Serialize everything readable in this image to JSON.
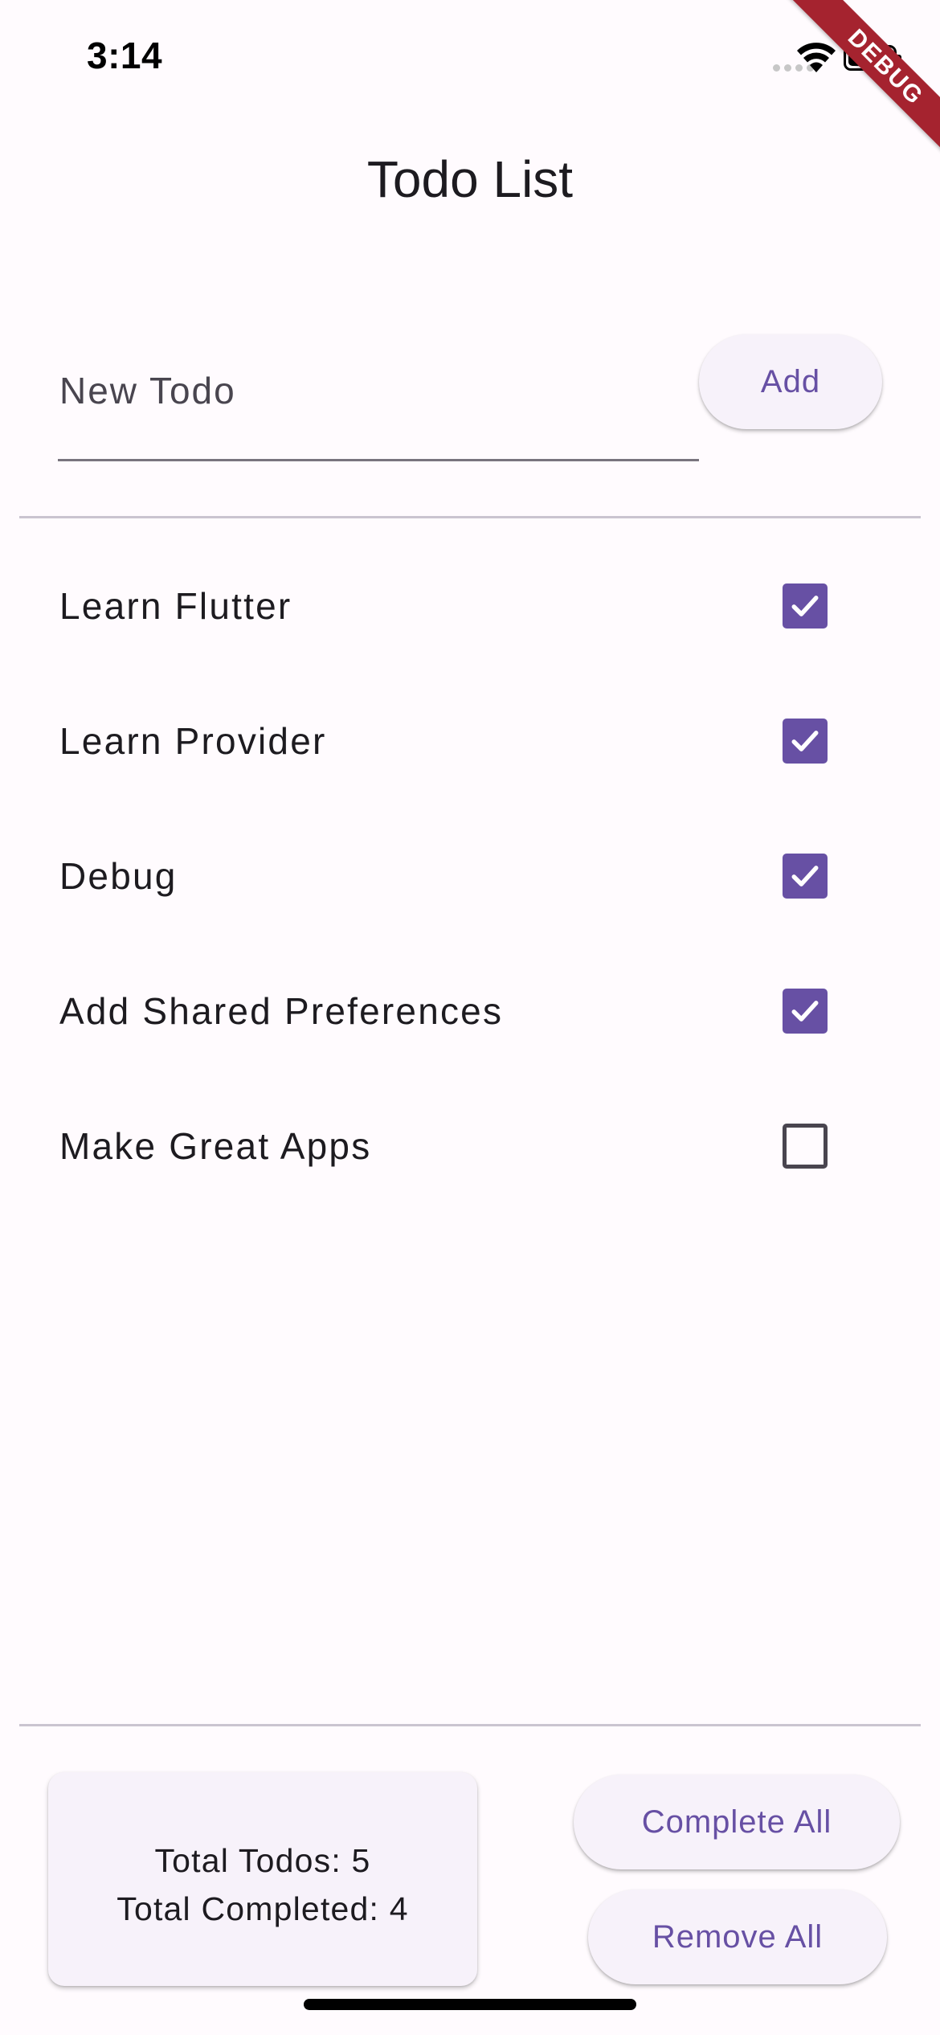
{
  "status_bar": {
    "time": "3:14"
  },
  "debug_banner": {
    "label": "DEBUG",
    "color": "#a5232f"
  },
  "app_bar": {
    "title": "Todo List"
  },
  "new_todo": {
    "placeholder": "New Todo",
    "value": "",
    "add_label": "Add"
  },
  "todos": [
    {
      "title": "Learn Flutter",
      "completed": true
    },
    {
      "title": "Learn Provider",
      "completed": true
    },
    {
      "title": "Debug",
      "completed": true
    },
    {
      "title": "Add Shared Preferences",
      "completed": true
    },
    {
      "title": "Make Great Apps",
      "completed": false
    }
  ],
  "summary": {
    "total_todos": "Total Todos: 5",
    "total_completed": "Total Completed: 4"
  },
  "actions": {
    "complete_all_label": "Complete All",
    "remove_all_label": "Remove All"
  },
  "colors": {
    "accent": "#6750a4",
    "background": "#fffbfe",
    "surface": "#f7f2fa",
    "divider": "#cac4d0"
  }
}
